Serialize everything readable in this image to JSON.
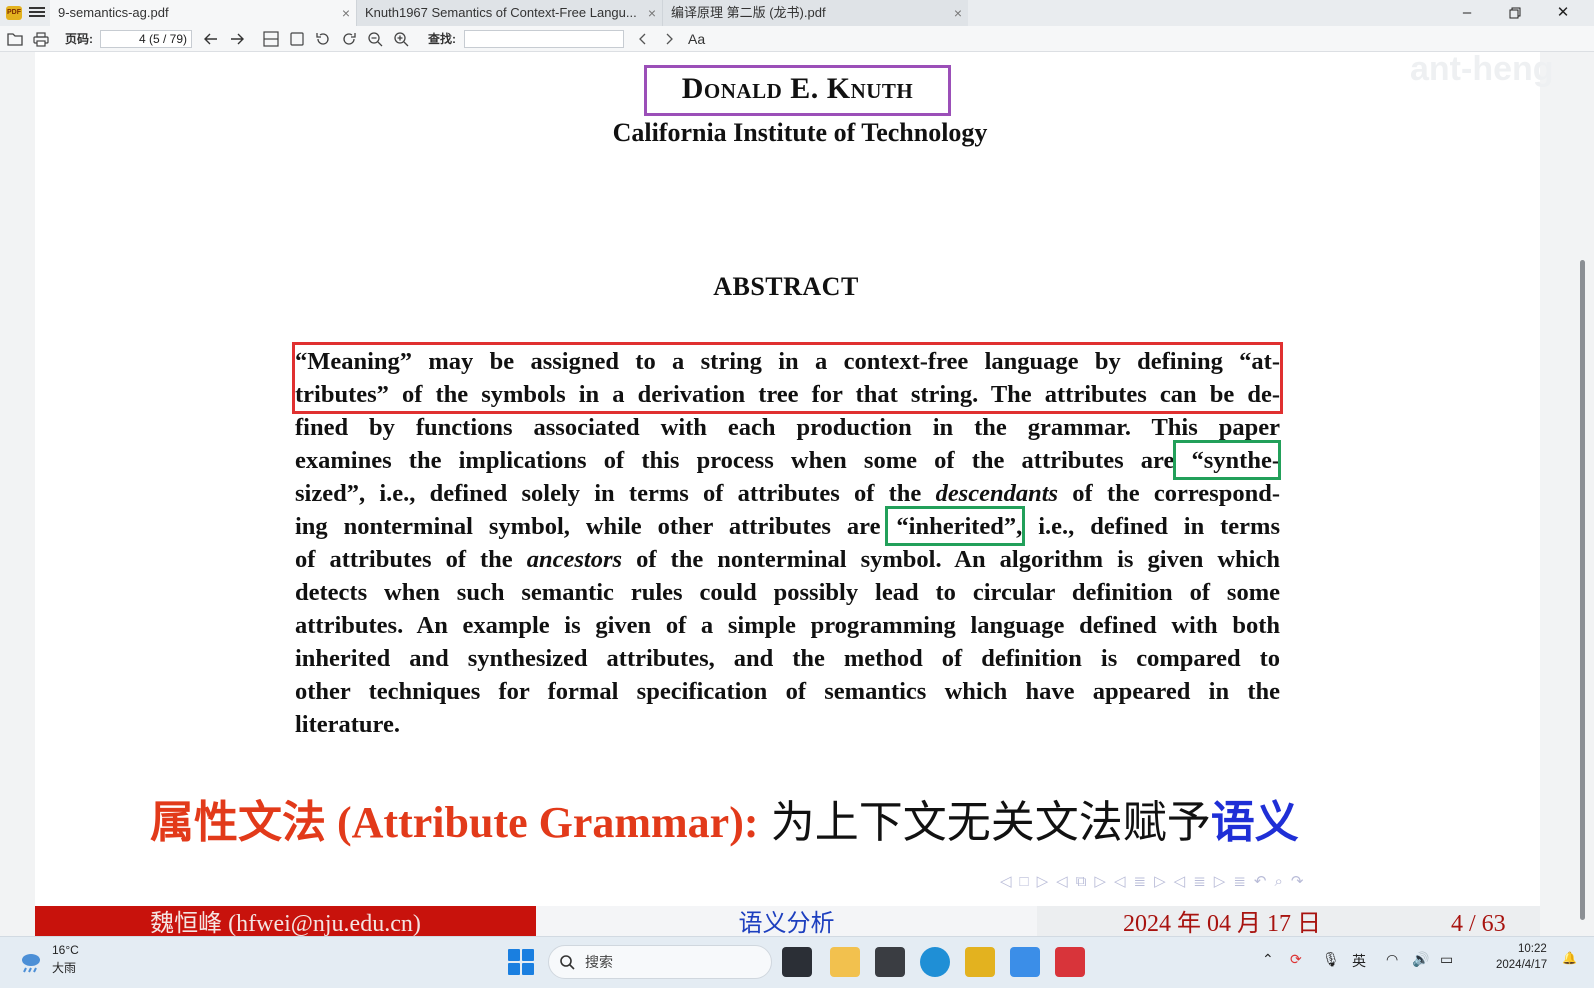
{
  "window": {
    "tabs": [
      {
        "label": "9-semantics-ag.pdf"
      },
      {
        "label": "Knuth1967 Semantics of Context-Free Langu..."
      },
      {
        "label": "编译原理 第二版 (龙书).pdf"
      }
    ],
    "close_glyph": "×"
  },
  "toolbar": {
    "page_label": "页码:",
    "page_value": "4 (5 / 79)",
    "find_label": "查找:",
    "find_value": "",
    "case_toggle": "Aa"
  },
  "watermark": "ant-heng",
  "paper": {
    "author": "Donald E. Knuth",
    "institution": "California Institute of Technology",
    "abstract_heading": "ABSTRACT",
    "abstract_lines": [
      [
        "“Meaning” may be assigned to a string in a context-free language by defining “at-"
      ],
      [
        "tributes” of the symbols in a derivation tree for that string. The attributes can be de-"
      ],
      [
        "fined by functions associated with each production in the grammar. This paper"
      ],
      [
        "examines the implications of this process when some of the attributes are “synthe-"
      ],
      [
        "sized”, i.e., defined solely in terms of attributes of the ",
        "descendants",
        " of the correspond-"
      ],
      [
        "ing nonterminal symbol, while other attributes are “inherited”, i.e., defined in terms"
      ],
      [
        "of attributes of the ",
        "ancestors",
        " of the nonterminal symbol. An algorithm is given which"
      ],
      [
        "detects when such semantic rules could possibly lead to circular definition of some"
      ],
      [
        "attributes. An example is given of a simple programming language defined with both"
      ],
      [
        "inherited and synthesized attributes, and the method of definition is compared to"
      ],
      [
        "other techniques for formal specification of semantics which have appeared in the"
      ],
      [
        "literature."
      ]
    ]
  },
  "slide": {
    "title_red": "属性文法 (Attribute Grammar):",
    "title_black": "为上下文无关文法赋予",
    "title_blue": "语义",
    "nav_symbols": [
      "◁",
      "□",
      "▷",
      "◁",
      "⧉",
      "▷",
      "◁",
      "≣",
      "▷",
      "◁",
      "≣",
      "▷",
      "≣",
      "↶",
      "⌕",
      "↷"
    ],
    "footer_author": "魏恒峰 (hfwei@nju.edu.cn)",
    "footer_topic": "语义分析",
    "footer_date": "2024 年 04 月 17 日",
    "footer_page": "4 / 63"
  },
  "taskbar": {
    "temperature": "16°C",
    "weather": "大雨",
    "search_placeholder": "搜索",
    "ime": "英",
    "time": "10:22",
    "date": "2024/4/17"
  },
  "colors": {
    "title_red": "#e23a1a",
    "title_blue": "#1f2fd6",
    "footer_red": "#c8120c",
    "box_red": "#e03030",
    "box_green": "#22a05a",
    "box_purple": "#9b4fb8"
  }
}
